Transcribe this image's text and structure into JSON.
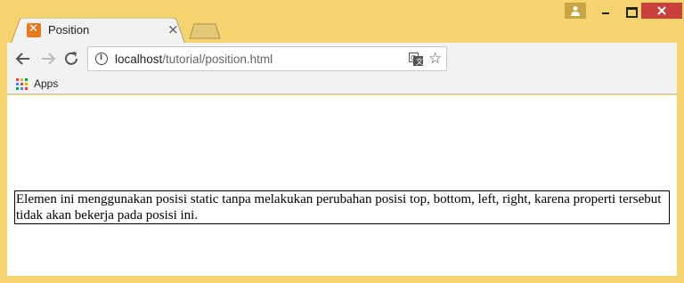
{
  "browser": {
    "tab": {
      "title": "Position"
    },
    "address_bar": {
      "host": "localhost",
      "path": "/tutorial/position.html"
    },
    "bookmarks": [
      {
        "label": "Apps"
      }
    ]
  },
  "page": {
    "static_text": "Elemen ini menggunakan posisi static tanpa melakukan perubahan posisi top, bottom, left, right, karena properti tersebut tidak akan bekerja pada posisi ini."
  },
  "colors": {
    "frame": "#f5d36e",
    "close_button": "#c9413a",
    "favicon": "#e87a1e"
  }
}
